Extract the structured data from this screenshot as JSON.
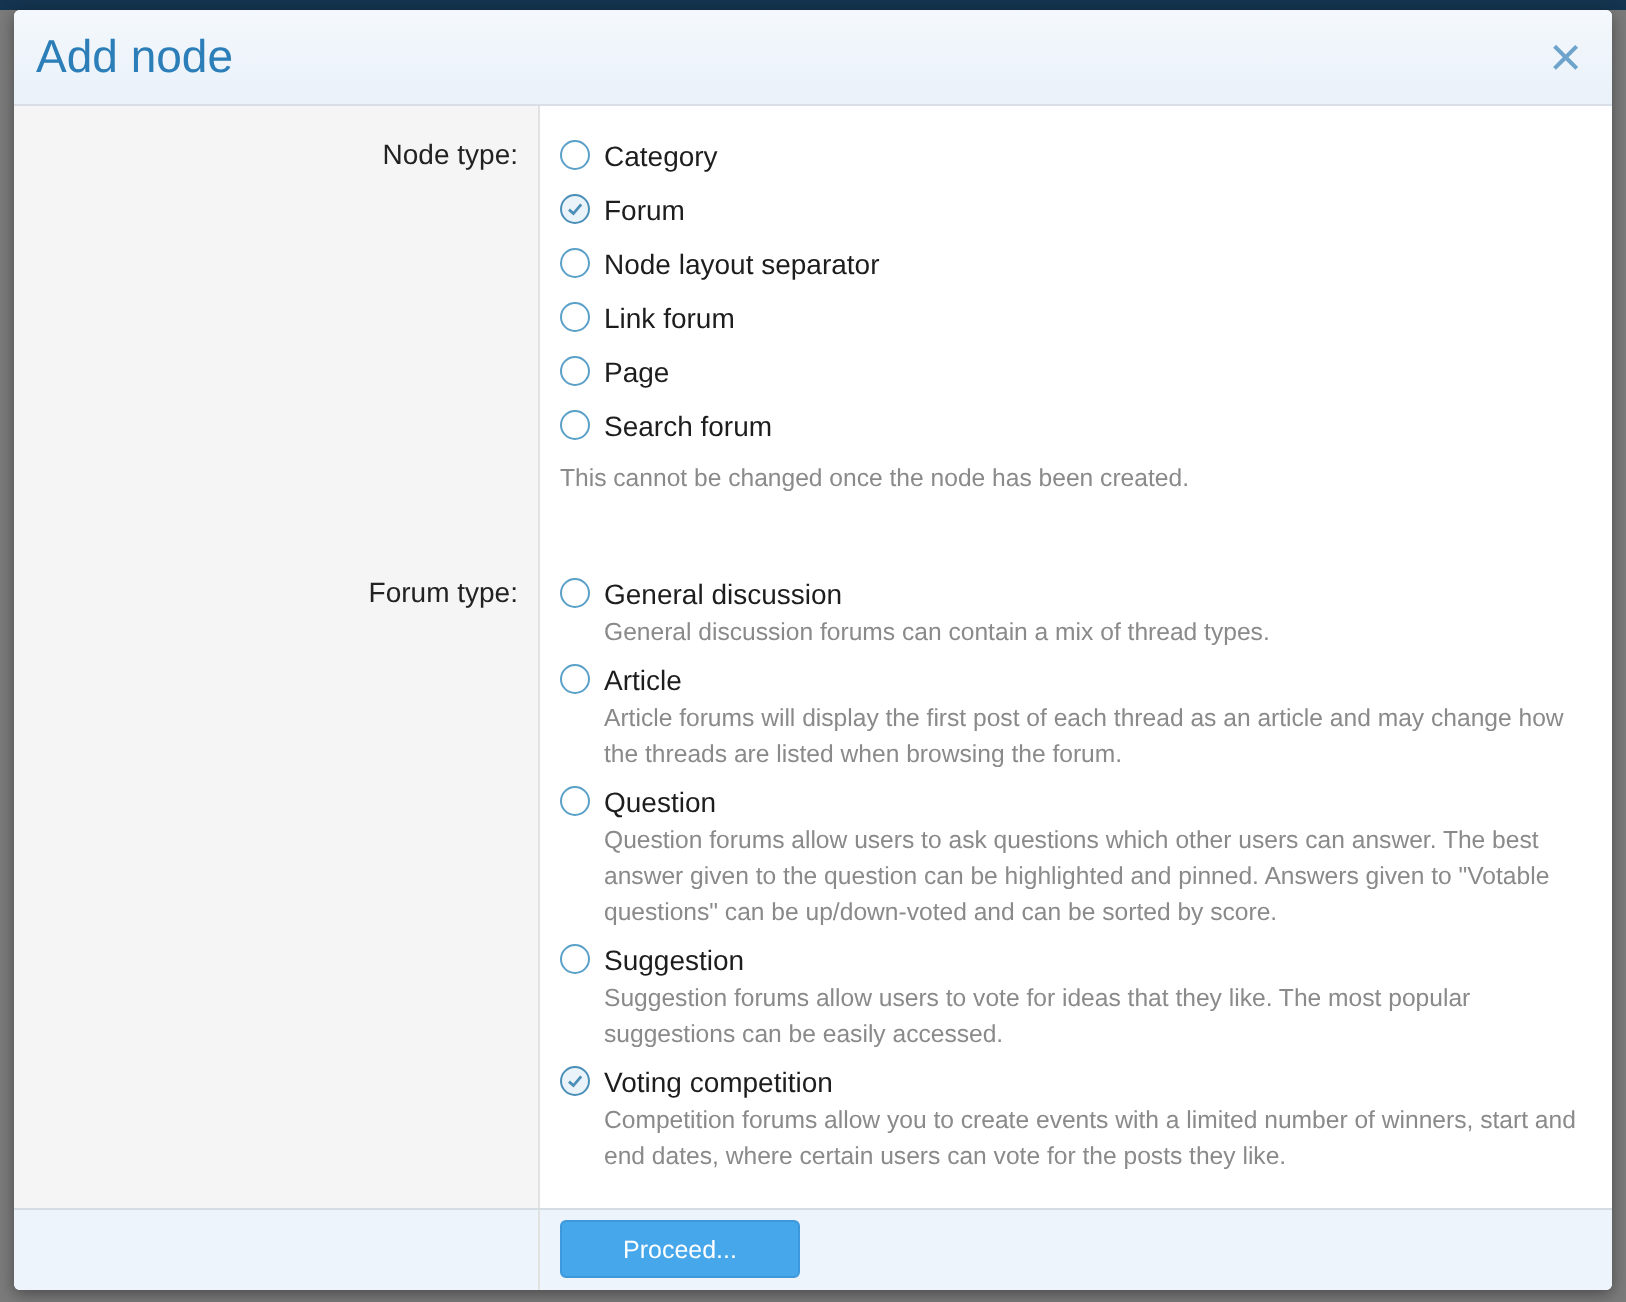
{
  "dialog": {
    "title": "Add node",
    "close": "×"
  },
  "fields": [
    {
      "label": "Node type:",
      "hint": "This cannot be changed once the node has been created.",
      "options": [
        {
          "label": "Category",
          "selected": false
        },
        {
          "label": "Forum",
          "selected": true
        },
        {
          "label": "Node layout separator",
          "selected": false
        },
        {
          "label": "Link forum",
          "selected": false
        },
        {
          "label": "Page",
          "selected": false
        },
        {
          "label": "Search forum",
          "selected": false
        }
      ]
    },
    {
      "label": "Forum type:",
      "options": [
        {
          "label": "General discussion",
          "selected": false,
          "description": "General discussion forums can contain a mix of thread types."
        },
        {
          "label": "Article",
          "selected": false,
          "description": "Article forums will display the first post of each thread as an article and may change how the threads are listed when browsing the forum."
        },
        {
          "label": "Question",
          "selected": false,
          "description": "Question forums allow users to ask questions which other users can answer. The best answer given to the question can be highlighted and pinned. Answers given to \"Votable questions\" can be up/down-voted and can be sorted by score."
        },
        {
          "label": "Suggestion",
          "selected": false,
          "description": "Suggestion forums allow users to vote for ideas that they like. The most popular suggestions can be easily accessed."
        },
        {
          "label": "Voting competition",
          "selected": true,
          "description": "Competition forums allow you to create events with a limited number of winners, start and end dates, where certain users can vote for the posts they like."
        }
      ]
    }
  ],
  "submit": "Proceed..."
}
